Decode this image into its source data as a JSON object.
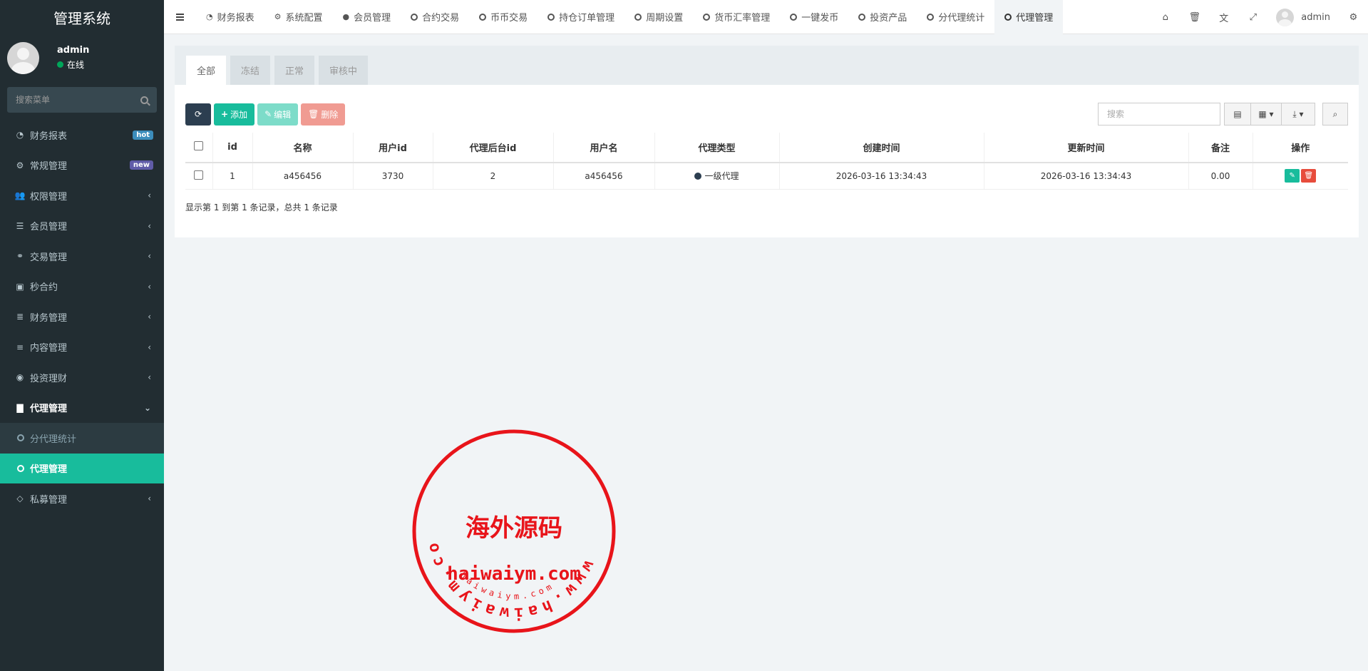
{
  "app": {
    "title": "管理系统"
  },
  "user": {
    "name": "admin",
    "status": "在线"
  },
  "sidebar": {
    "search_placeholder": "搜索菜单",
    "items": [
      {
        "label": "财务报表",
        "icon": "dashboard-icon",
        "badge": "hot"
      },
      {
        "label": "常规管理",
        "icon": "cogs-icon",
        "badge": "new"
      },
      {
        "label": "权限管理",
        "icon": "group-icon"
      },
      {
        "label": "会员管理",
        "icon": "list-icon"
      },
      {
        "label": "交易管理",
        "icon": "handshake-icon"
      },
      {
        "label": "秒合约",
        "icon": "calendar-icon"
      },
      {
        "label": "财务管理",
        "icon": "database-icon"
      },
      {
        "label": "内容管理",
        "icon": "align-left-icon"
      },
      {
        "label": "投资理财",
        "icon": "compass-icon"
      },
      {
        "label": "代理管理",
        "icon": "briefcase-icon"
      },
      {
        "label": "分代理统计",
        "icon": "circle-icon"
      },
      {
        "label": "代理管理",
        "icon": "circle-icon"
      },
      {
        "label": "私募管理",
        "icon": "diamond-icon"
      }
    ]
  },
  "topnav": {
    "tabs": [
      {
        "label": "财务报表",
        "icon": "dashboard-icon"
      },
      {
        "label": "系统配置",
        "icon": "gear-icon"
      },
      {
        "label": "会员管理",
        "icon": "user-icon"
      },
      {
        "label": "合约交易",
        "icon": "circle-icon"
      },
      {
        "label": "币币交易",
        "icon": "circle-icon"
      },
      {
        "label": "持仓订单管理",
        "icon": "circle-icon"
      },
      {
        "label": "周期设置",
        "icon": "circle-icon"
      },
      {
        "label": "货币汇率管理",
        "icon": "circle-icon"
      },
      {
        "label": "一键发币",
        "icon": "circle-icon"
      },
      {
        "label": "投资产品",
        "icon": "circle-icon"
      },
      {
        "label": "分代理统计",
        "icon": "circle-icon"
      },
      {
        "label": "代理管理",
        "icon": "circle-icon"
      }
    ],
    "user": "admin"
  },
  "panel": {
    "tabs": [
      "全部",
      "冻结",
      "正常",
      "审核中"
    ],
    "toolbar": {
      "add": "添加",
      "edit": "编辑",
      "delete": "删除",
      "search_placeholder": "搜索"
    },
    "columns": [
      "id",
      "名称",
      "用户id",
      "代理后台id",
      "用户名",
      "代理类型",
      "创建时间",
      "更新时间",
      "备注",
      "操作"
    ],
    "rows": [
      {
        "id": "1",
        "name": "a456456",
        "user_id": "3730",
        "admin_id": "2",
        "username": "a456456",
        "agent_type": "一级代理",
        "created": "2026-03-16 13:34:43",
        "updated": "2026-03-16 13:34:43",
        "remark": "0.00"
      }
    ],
    "summary": "显示第 1 到第 1 条记录，总共 1 条记录"
  },
  "watermark": {
    "ring_text": "www.haiwaiym.com",
    "center_text": "海外源码",
    "domain_text": "haiwaiym.com",
    "small_text": "haiwaiym.com"
  },
  "colors": {
    "sidebar": "#222d32",
    "accent": "#18bc9c",
    "danger": "#e74c3c",
    "stamp": "#e8141a"
  }
}
